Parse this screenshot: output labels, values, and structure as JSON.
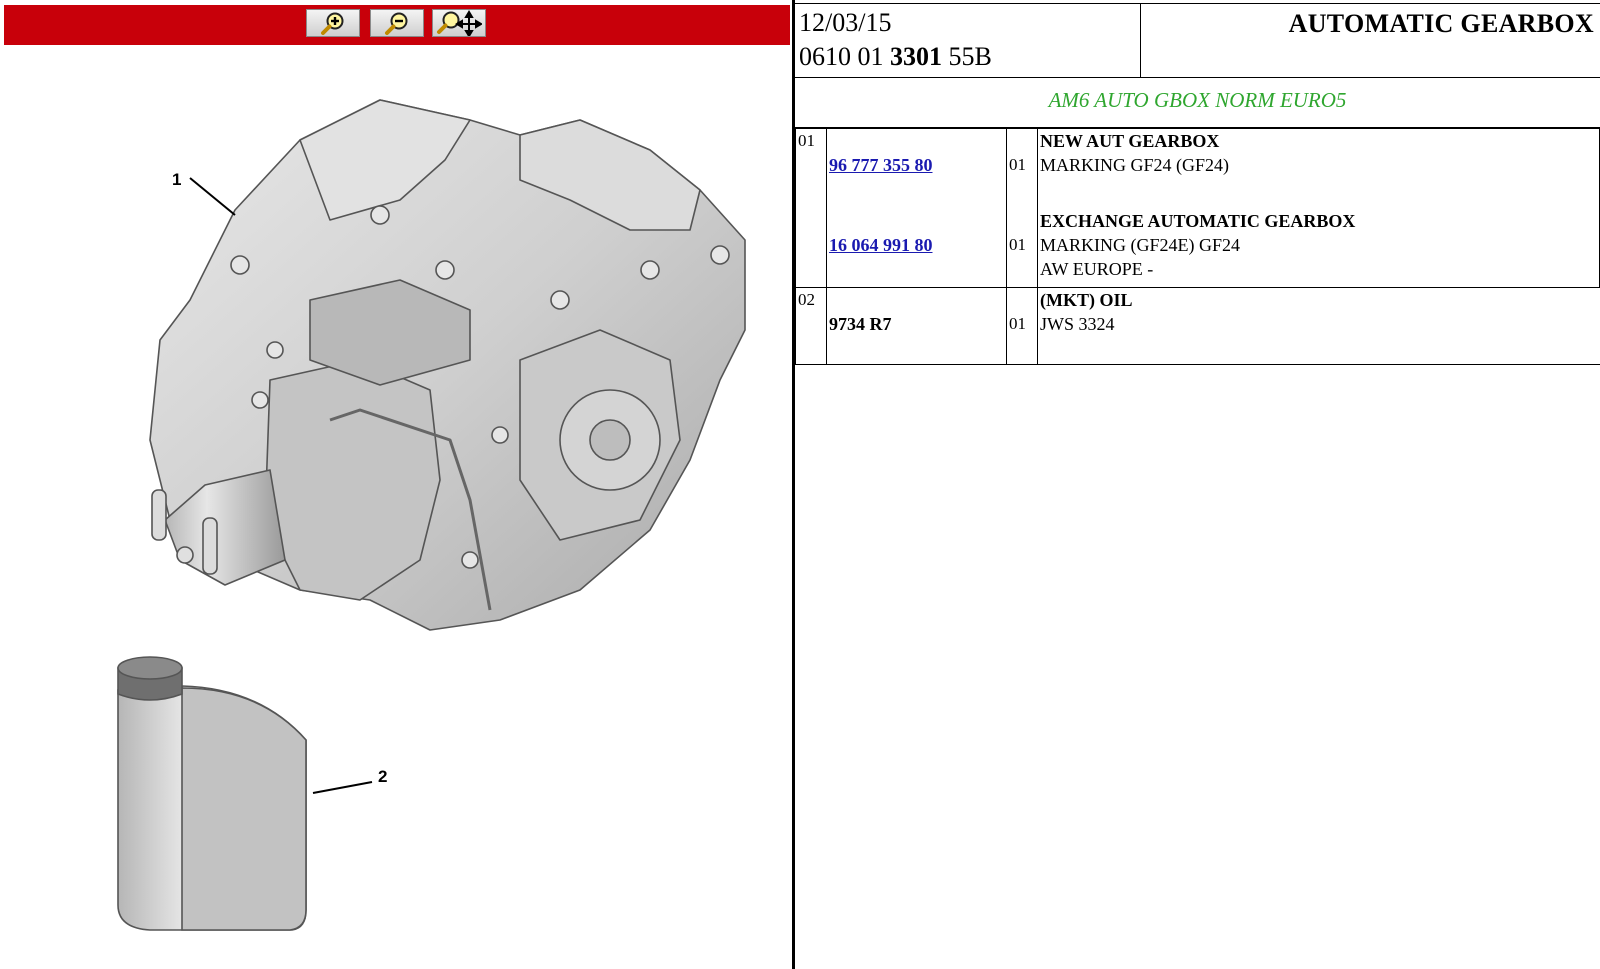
{
  "toolbar": {
    "zoom_in_icon": "zoom-in-icon",
    "zoom_out_icon": "zoom-out-icon",
    "zoom_pan_icon": "zoom-pan-icon",
    "bar_color": "#c8000a"
  },
  "diagram": {
    "callout_1": "1",
    "callout_2": "2"
  },
  "header": {
    "date": "12/03/15",
    "ref_prefix": "0610 01 ",
    "ref_bold": "3301",
    "ref_suffix": " 55B",
    "title": "AUTOMATIC GEARBOX"
  },
  "section": {
    "title": "AM6 AUTO GBOX NORM EURO5",
    "color": "#2fa62f"
  },
  "parts": [
    {
      "num": "01",
      "entries": [
        {
          "part_no": "96 777 355 80",
          "link": true,
          "qty": "01",
          "title": "NEW AUT GEARBOX",
          "lines": [
            "MARKING GF24 (GF24)"
          ]
        },
        {
          "part_no": "16 064 991 80",
          "link": true,
          "qty": "01",
          "title": "EXCHANGE AUTOMATIC GEARBOX",
          "lines": [
            "MARKING (GF24E) GF24",
            "AW EUROPE -"
          ]
        }
      ]
    },
    {
      "num": "02",
      "entries": [
        {
          "part_no": "9734 R7",
          "link": false,
          "qty": "01",
          "title": "(MKT) OIL",
          "lines": [
            "JWS 3324"
          ]
        }
      ]
    }
  ]
}
